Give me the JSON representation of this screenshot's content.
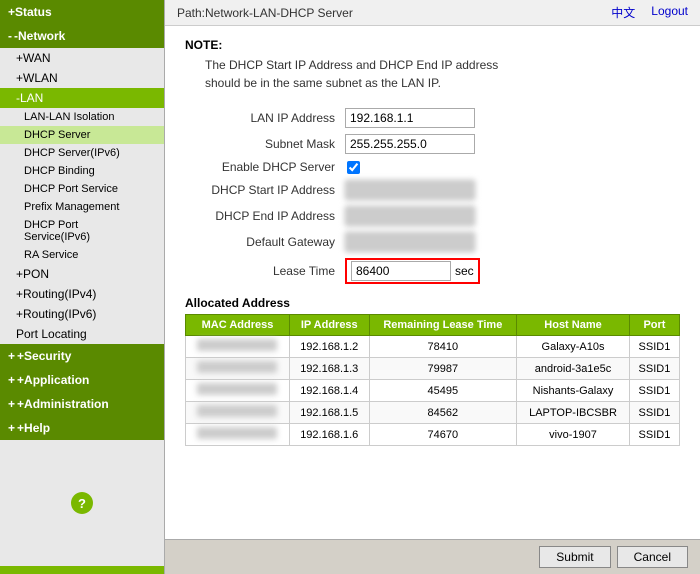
{
  "topbar": {
    "path": "Path:Network-LAN-DHCP Server",
    "lang": "中文",
    "logout": "Logout"
  },
  "sidebar": {
    "status": "+Status",
    "network": "-Network",
    "wan": "+WAN",
    "wlan": "+WLAN",
    "lan": "-LAN",
    "lan_isolation": "LAN-LAN Isolation",
    "dhcp_server": "DHCP Server",
    "dhcp_server_ipv6": "DHCP Server(IPv6)",
    "dhcp_binding": "DHCP Binding",
    "dhcp_port_service": "DHCP Port Service",
    "prefix_management": "Prefix Management",
    "dhcp_port_service_ipv6": "DHCP Port Service(IPv6)",
    "ra_service": "RA Service",
    "pon": "+PON",
    "routing_ipv4": "+Routing(IPv4)",
    "routing_ipv6": "+Routing(IPv6)",
    "port_locating": "Port Locating",
    "security": "+Security",
    "application": "+Application",
    "administration": "+Administration",
    "help": "+Help"
  },
  "note": {
    "title": "NOTE:",
    "line1": "The DHCP Start IP Address and DHCP End IP address",
    "line2": "should be in the same subnet as the LAN IP."
  },
  "form": {
    "lan_ip_label": "LAN IP Address",
    "lan_ip_value": "192.168.1.1",
    "subnet_mask_label": "Subnet Mask",
    "subnet_mask_value": "255.255.255.0",
    "enable_dhcp_label": "Enable DHCP Server",
    "dhcp_start_label": "DHCP Start IP Address",
    "dhcp_start_value": "192.",
    "dhcp_end_label": "DHCP End IP Address",
    "dhcp_end_value": "192.",
    "gateway_label": "Default Gateway",
    "gateway_value": "192.",
    "lease_time_label": "Lease Time",
    "lease_time_value": "86400",
    "sec_label": "sec"
  },
  "table": {
    "title": "Allocated Address",
    "headers": [
      "MAC Address",
      "IP Address",
      "Remaining Lease Time",
      "Host Name",
      "Port"
    ],
    "rows": [
      {
        "mac": "8a:",
        "ip": "192.168.1.2",
        "remaining": "78410",
        "host": "Galaxy-A10s",
        "port": "SSID1"
      },
      {
        "mac": "b0:",
        "ip": "192.168.1.3",
        "remaining": "79987",
        "host": "android-3a1e5c",
        "port": "SSID1"
      },
      {
        "mac": "3c:",
        "ip": "192.168.1.4",
        "remaining": "45495",
        "host": "Nishants-Galaxy",
        "port": "SSID1"
      },
      {
        "mac": "3c:",
        "ip": "192.168.1.5",
        "remaining": "84562",
        "host": "LAPTOP-IBCSBR",
        "port": "SSID1"
      },
      {
        "mac": "4a:",
        "ip": "192.168.1.6",
        "remaining": "74670",
        "host": "vivo-1907",
        "port": "SSID1"
      }
    ]
  },
  "buttons": {
    "submit": "Submit",
    "cancel": "Cancel"
  }
}
